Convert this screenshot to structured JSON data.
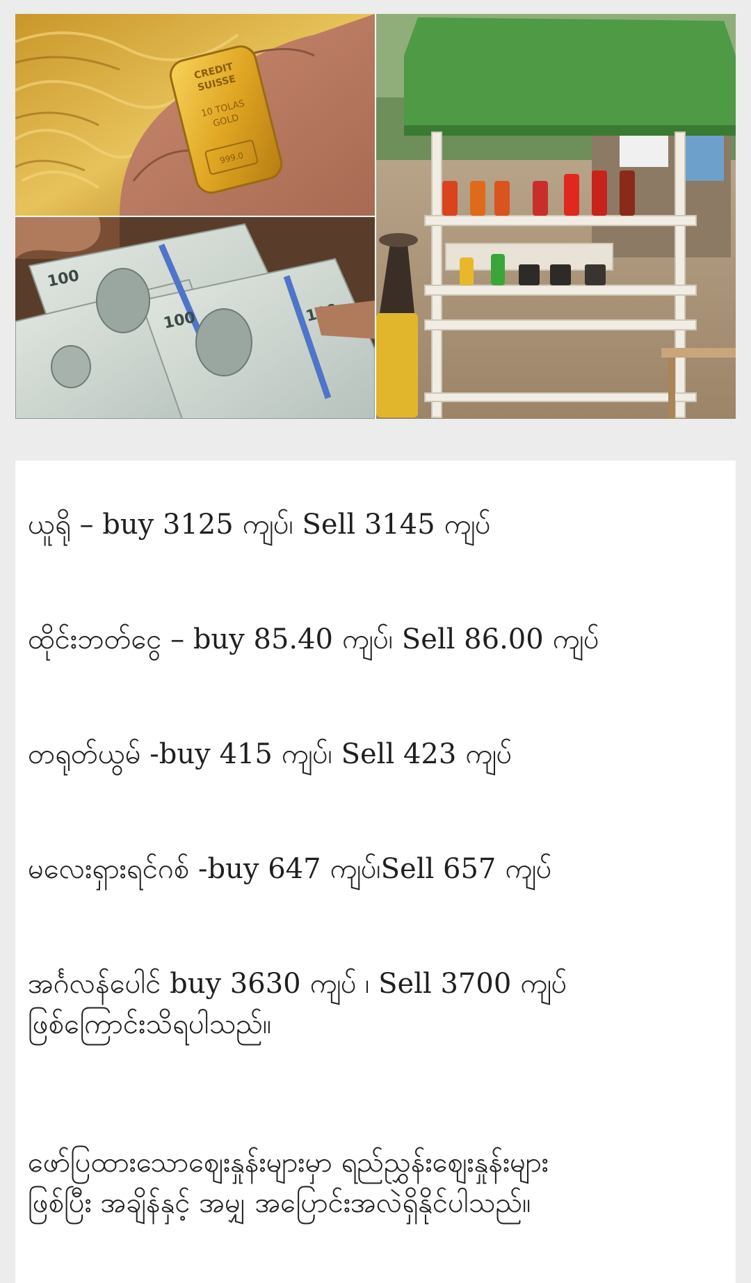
{
  "images": {
    "gold_bar": {
      "alt": "gold-bar-in-hand",
      "engraving": [
        "CREDIT",
        "SUISSE",
        "10 TOLAS",
        "GOLD",
        "999.0"
      ]
    },
    "dollars": {
      "alt": "us-dollar-banknotes",
      "denomination": "100"
    },
    "fuel_stall": {
      "alt": "roadside-fuel-stall"
    }
  },
  "rates": [
    "ယူရို – buy 3125 ကျပ်၊ Sell 3145 ကျပ်",
    "ထိုင်းဘတ်ငွေ – buy 85.40 ကျပ်၊ Sell 86.00 ကျပ်",
    "တရုတ်ယွမ် -buy 415 ကျပ်၊ Sell 423 ကျပ်",
    "မလေးရှားရင်ဂစ် -buy 647 ကျပ်၊Sell 657 ကျပ်"
  ],
  "pound_note": {
    "line1": "အင်္ဂလန်ပေါင် buy 3630 ကျပ် ၊ Sell 3700 ကျပ်",
    "line2": "ဖြစ်ကြောင်းသိရပါသည်။"
  },
  "disclaimer": {
    "line1": "ဖော်ပြထားသောဈေးနှုန်းများမှာ ရည်ညွှန်းဈေးနှုန်းများ",
    "line2": "ဖြစ်ပြီး အချိန်နှင့် အမျှ အပြောင်းအလဲရှိနိုင်ပါသည်။"
  },
  "colors": {
    "background": "#ececec",
    "card": "#ffffff",
    "text": "#1f1f1f",
    "awning": "#4e9a45",
    "gold": "#d9a521"
  }
}
